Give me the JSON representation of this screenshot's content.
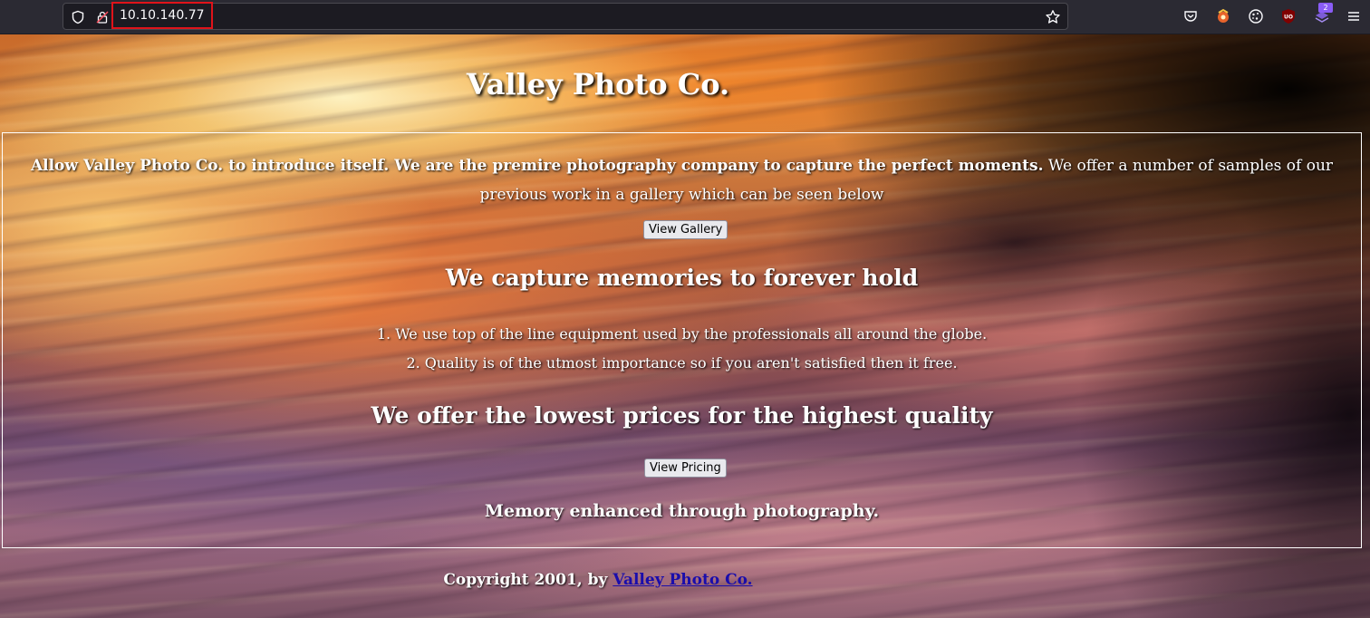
{
  "browser": {
    "url": "10.10.140.77",
    "toolbar_icons": [
      "pocket-icon",
      "extension-icon",
      "cookie-icon",
      "ublock-icon",
      "extension-badge-icon",
      "menu-icon"
    ],
    "badge_count": "2"
  },
  "page": {
    "title": "Valley Photo Co.",
    "intro_bold": "Allow Valley Photo Co. to introduce itself. We are the premire photography company to capture the perfect moments.",
    "intro_rest": " We offer a number of samples of our previous work in a gallery which can be seen below",
    "gallery_button": "View Gallery",
    "heading1": "We capture memories to forever hold",
    "list_items": [
      "1. We use top of the line equipment used by the professionals all around the globe.",
      "2. Quality is of the utmost importance so if you aren't satisfied then it free."
    ],
    "heading2": "We offer the lowest prices for the highest quality",
    "pricing_button": "View Pricing",
    "tagline": "Memory enhanced through photography.",
    "footer_prefix": "Copyright 2001, by ",
    "footer_link": "Valley Photo Co."
  }
}
